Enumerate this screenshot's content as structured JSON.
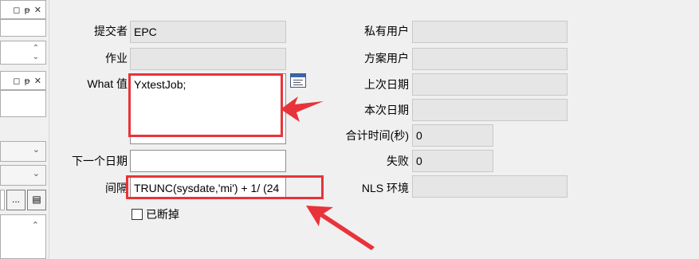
{
  "form": {
    "submitter": {
      "label": "提交者",
      "value": "EPC"
    },
    "job": {
      "label": "作业",
      "value": ""
    },
    "what": {
      "label": "What 值",
      "value": "YxtestJob;"
    },
    "next_date": {
      "label": "下一个日期",
      "value": ""
    },
    "interval": {
      "label": "间隔",
      "value": "TRUNC(sysdate,'mi') + 1/ (24"
    },
    "broken": {
      "label": "已断掉",
      "checked": false
    },
    "private_user": {
      "label": "私有用户",
      "value": ""
    },
    "schema_user": {
      "label": "方案用户",
      "value": ""
    },
    "last_date": {
      "label": "上次日期",
      "value": ""
    },
    "this_date": {
      "label": "本次日期",
      "value": ""
    },
    "total_time": {
      "label": "合计时间(秒)",
      "value": "0"
    },
    "failures": {
      "label": "失败",
      "value": "0"
    },
    "nls_env": {
      "label": "NLS 环境",
      "value": ""
    }
  },
  "side_panel": {
    "more_button_label": "..."
  },
  "icons": {
    "pin": "pin-icon",
    "close": "close-icon",
    "restore": "restore-icon",
    "editor": "editor-icon"
  },
  "colors": {
    "annotation_red": "#e8333a"
  }
}
